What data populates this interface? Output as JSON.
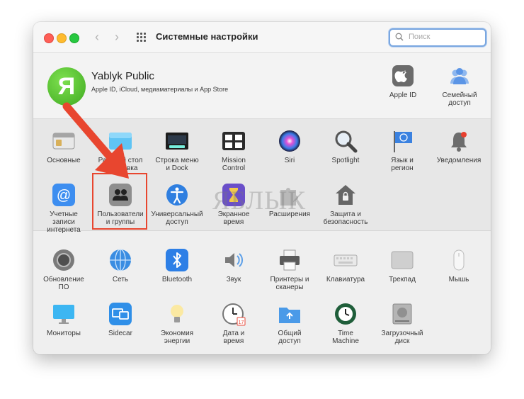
{
  "window": {
    "title": "Системные настройки"
  },
  "search": {
    "placeholder": "Поиск"
  },
  "profile": {
    "avatar_letter": "Я",
    "name": "Yablyk Public",
    "subtitle": "Apple ID, iCloud, медиаматериалы и App Store",
    "apple_id": {
      "label": "Apple ID",
      "icon": "apple-icon"
    },
    "family": {
      "label_1": "Семейный",
      "label_2": "доступ",
      "icon": "family-sharing-icon"
    }
  },
  "row1": [
    {
      "l1": "Основные",
      "l2": "",
      "icon": "general-icon"
    },
    {
      "l1": "Рабочий стол",
      "l2": "и заставка",
      "icon": "desktop-icon"
    },
    {
      "l1": "Строка меню",
      "l2": "и Dock",
      "icon": "dock-icon"
    },
    {
      "l1": "Mission",
      "l2": "Control",
      "icon": "mission-control-icon"
    },
    {
      "l1": "Siri",
      "l2": "",
      "icon": "siri-icon"
    },
    {
      "l1": "Spotlight",
      "l2": "",
      "icon": "spotlight-icon"
    },
    {
      "l1": "Язык и",
      "l2": "регион",
      "icon": "flag-icon"
    },
    {
      "l1": "Уведомления",
      "l2": "",
      "icon": "bell-icon"
    }
  ],
  "row2": [
    {
      "l1": "Учетные",
      "l2": "записи интернета",
      "icon": "at-icon"
    },
    {
      "l1": "Пользователи",
      "l2": "и группы",
      "icon": "users-icon"
    },
    {
      "l1": "Универсальный",
      "l2": "доступ",
      "icon": "accessibility-icon"
    },
    {
      "l1": "Экранное",
      "l2": "время",
      "icon": "hourglass-icon"
    },
    {
      "l1": "Расширения",
      "l2": "",
      "icon": "puzzle-icon"
    },
    {
      "l1": "Защита и",
      "l2": "безопасность",
      "icon": "house-lock-icon"
    }
  ],
  "row3": [
    {
      "l1": "Обновление",
      "l2": "ПО",
      "icon": "software-update-icon"
    },
    {
      "l1": "Сеть",
      "l2": "",
      "icon": "globe-icon"
    },
    {
      "l1": "Bluetooth",
      "l2": "",
      "icon": "bluetooth-icon"
    },
    {
      "l1": "Звук",
      "l2": "",
      "icon": "speaker-icon"
    },
    {
      "l1": "Принтеры и",
      "l2": "сканеры",
      "icon": "printer-icon"
    },
    {
      "l1": "Клавиатура",
      "l2": "",
      "icon": "keyboard-icon"
    },
    {
      "l1": "Трекпад",
      "l2": "",
      "icon": "trackpad-icon"
    },
    {
      "l1": "Мышь",
      "l2": "",
      "icon": "mouse-icon"
    }
  ],
  "row4": [
    {
      "l1": "Мониторы",
      "l2": "",
      "icon": "display-icon"
    },
    {
      "l1": "Sidecar",
      "l2": "",
      "icon": "sidecar-icon"
    },
    {
      "l1": "Экономия",
      "l2": "энергии",
      "icon": "bulb-icon"
    },
    {
      "l1": "Дата и",
      "l2": "время",
      "icon": "clock-icon"
    },
    {
      "l1": "Общий",
      "l2": "доступ",
      "icon": "sharing-folder-icon"
    },
    {
      "l1": "Time",
      "l2": "Machine",
      "icon": "time-machine-icon"
    },
    {
      "l1": "Загрузочный",
      "l2": "диск",
      "icon": "disk-icon"
    }
  ],
  "clock_date": "17",
  "watermark": "ЯБЛЫК",
  "colors": {
    "highlight": "#e8462f",
    "search_focus": "#7aa7e0"
  }
}
